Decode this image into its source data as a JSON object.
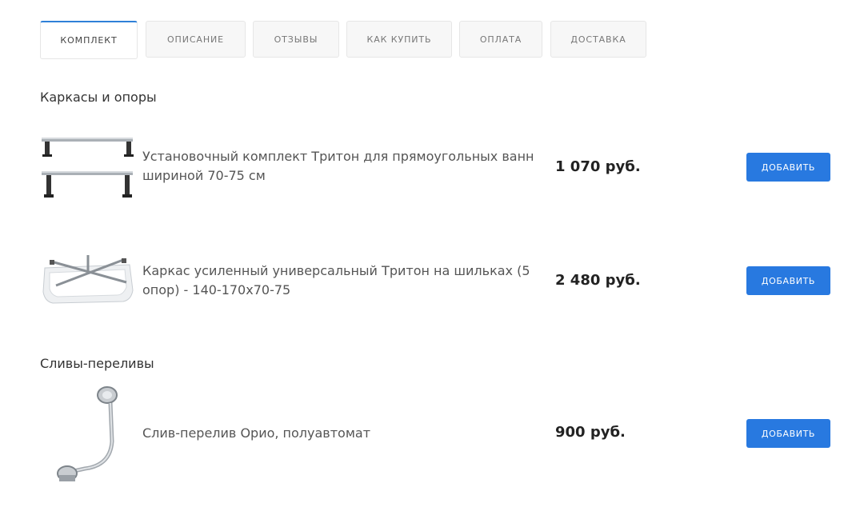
{
  "tabs": [
    {
      "label": "КОМПЛЕКТ",
      "active": true
    },
    {
      "label": "ОПИСАНИЕ",
      "active": false
    },
    {
      "label": "ОТЗЫВЫ",
      "active": false
    },
    {
      "label": "КАК КУПИТЬ",
      "active": false
    },
    {
      "label": "ОПЛАТА",
      "active": false
    },
    {
      "label": "ДОСТАВКА",
      "active": false
    }
  ],
  "sections": [
    {
      "title": "Каркасы и опоры",
      "products": [
        {
          "name": "Установочный комплект Тритон для прямоугольных ванн шириной 70-75 см",
          "price": "1 070 руб.",
          "button": "ДОБАВИТЬ",
          "thumb_icon": "frame-legs-icon"
        },
        {
          "name": "Каркас усиленный универсальный Тритон на шильках (5 опор) - 140-170х70-75",
          "price": "2 480 руб.",
          "button": "ДОБАВИТЬ",
          "thumb_icon": "bathtub-frame-icon"
        }
      ]
    },
    {
      "title": "Сливы-переливы",
      "products": [
        {
          "name": "Слив-перелив Орио, полуавтомат",
          "price": "900 руб.",
          "button": "ДОБАВИТЬ",
          "thumb_icon": "drain-overflow-icon"
        }
      ]
    }
  ],
  "colors": {
    "accent": "#2f80d8",
    "button": "#2879e0"
  }
}
